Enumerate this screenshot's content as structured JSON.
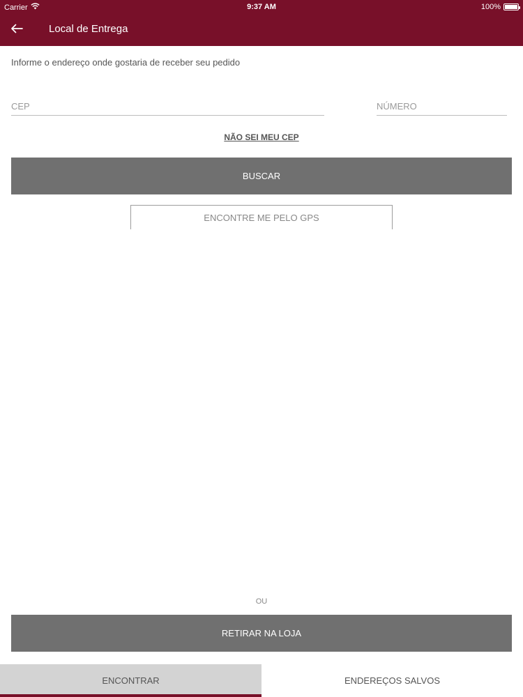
{
  "status_bar": {
    "carrier": "Carrier",
    "time": "9:37 AM",
    "battery": "100%",
    "battery_level": 1.0,
    "wifi_icon": "wifi-icon",
    "battery_icon": "battery-icon"
  },
  "header": {
    "back_icon": "arrow-left-icon",
    "title": "Local de Entrega",
    "background_color": "#781029"
  },
  "form": {
    "intro": "Informe o endereço onde gostaria de receber seu pedido",
    "cep_placeholder": "CEP",
    "cep_value": "",
    "numero_placeholder": "NÚMERO",
    "numero_value": "",
    "dont_know_cep": "NÃO SEI MEU CEP",
    "search_label": "BUSCAR",
    "gps_label": "ENCONTRE ME PELO GPS"
  },
  "alternative": {
    "or_label": "OU",
    "pickup_label": "RETIRAR NA LOJA"
  },
  "tabs": [
    {
      "label": "ENCONTRAR",
      "active": true
    },
    {
      "label": "ENDEREÇOS SALVOS",
      "active": false
    }
  ],
  "colors": {
    "brand": "#781029",
    "button_gray": "#707070",
    "active_tab_bg": "#d3d3d3"
  }
}
